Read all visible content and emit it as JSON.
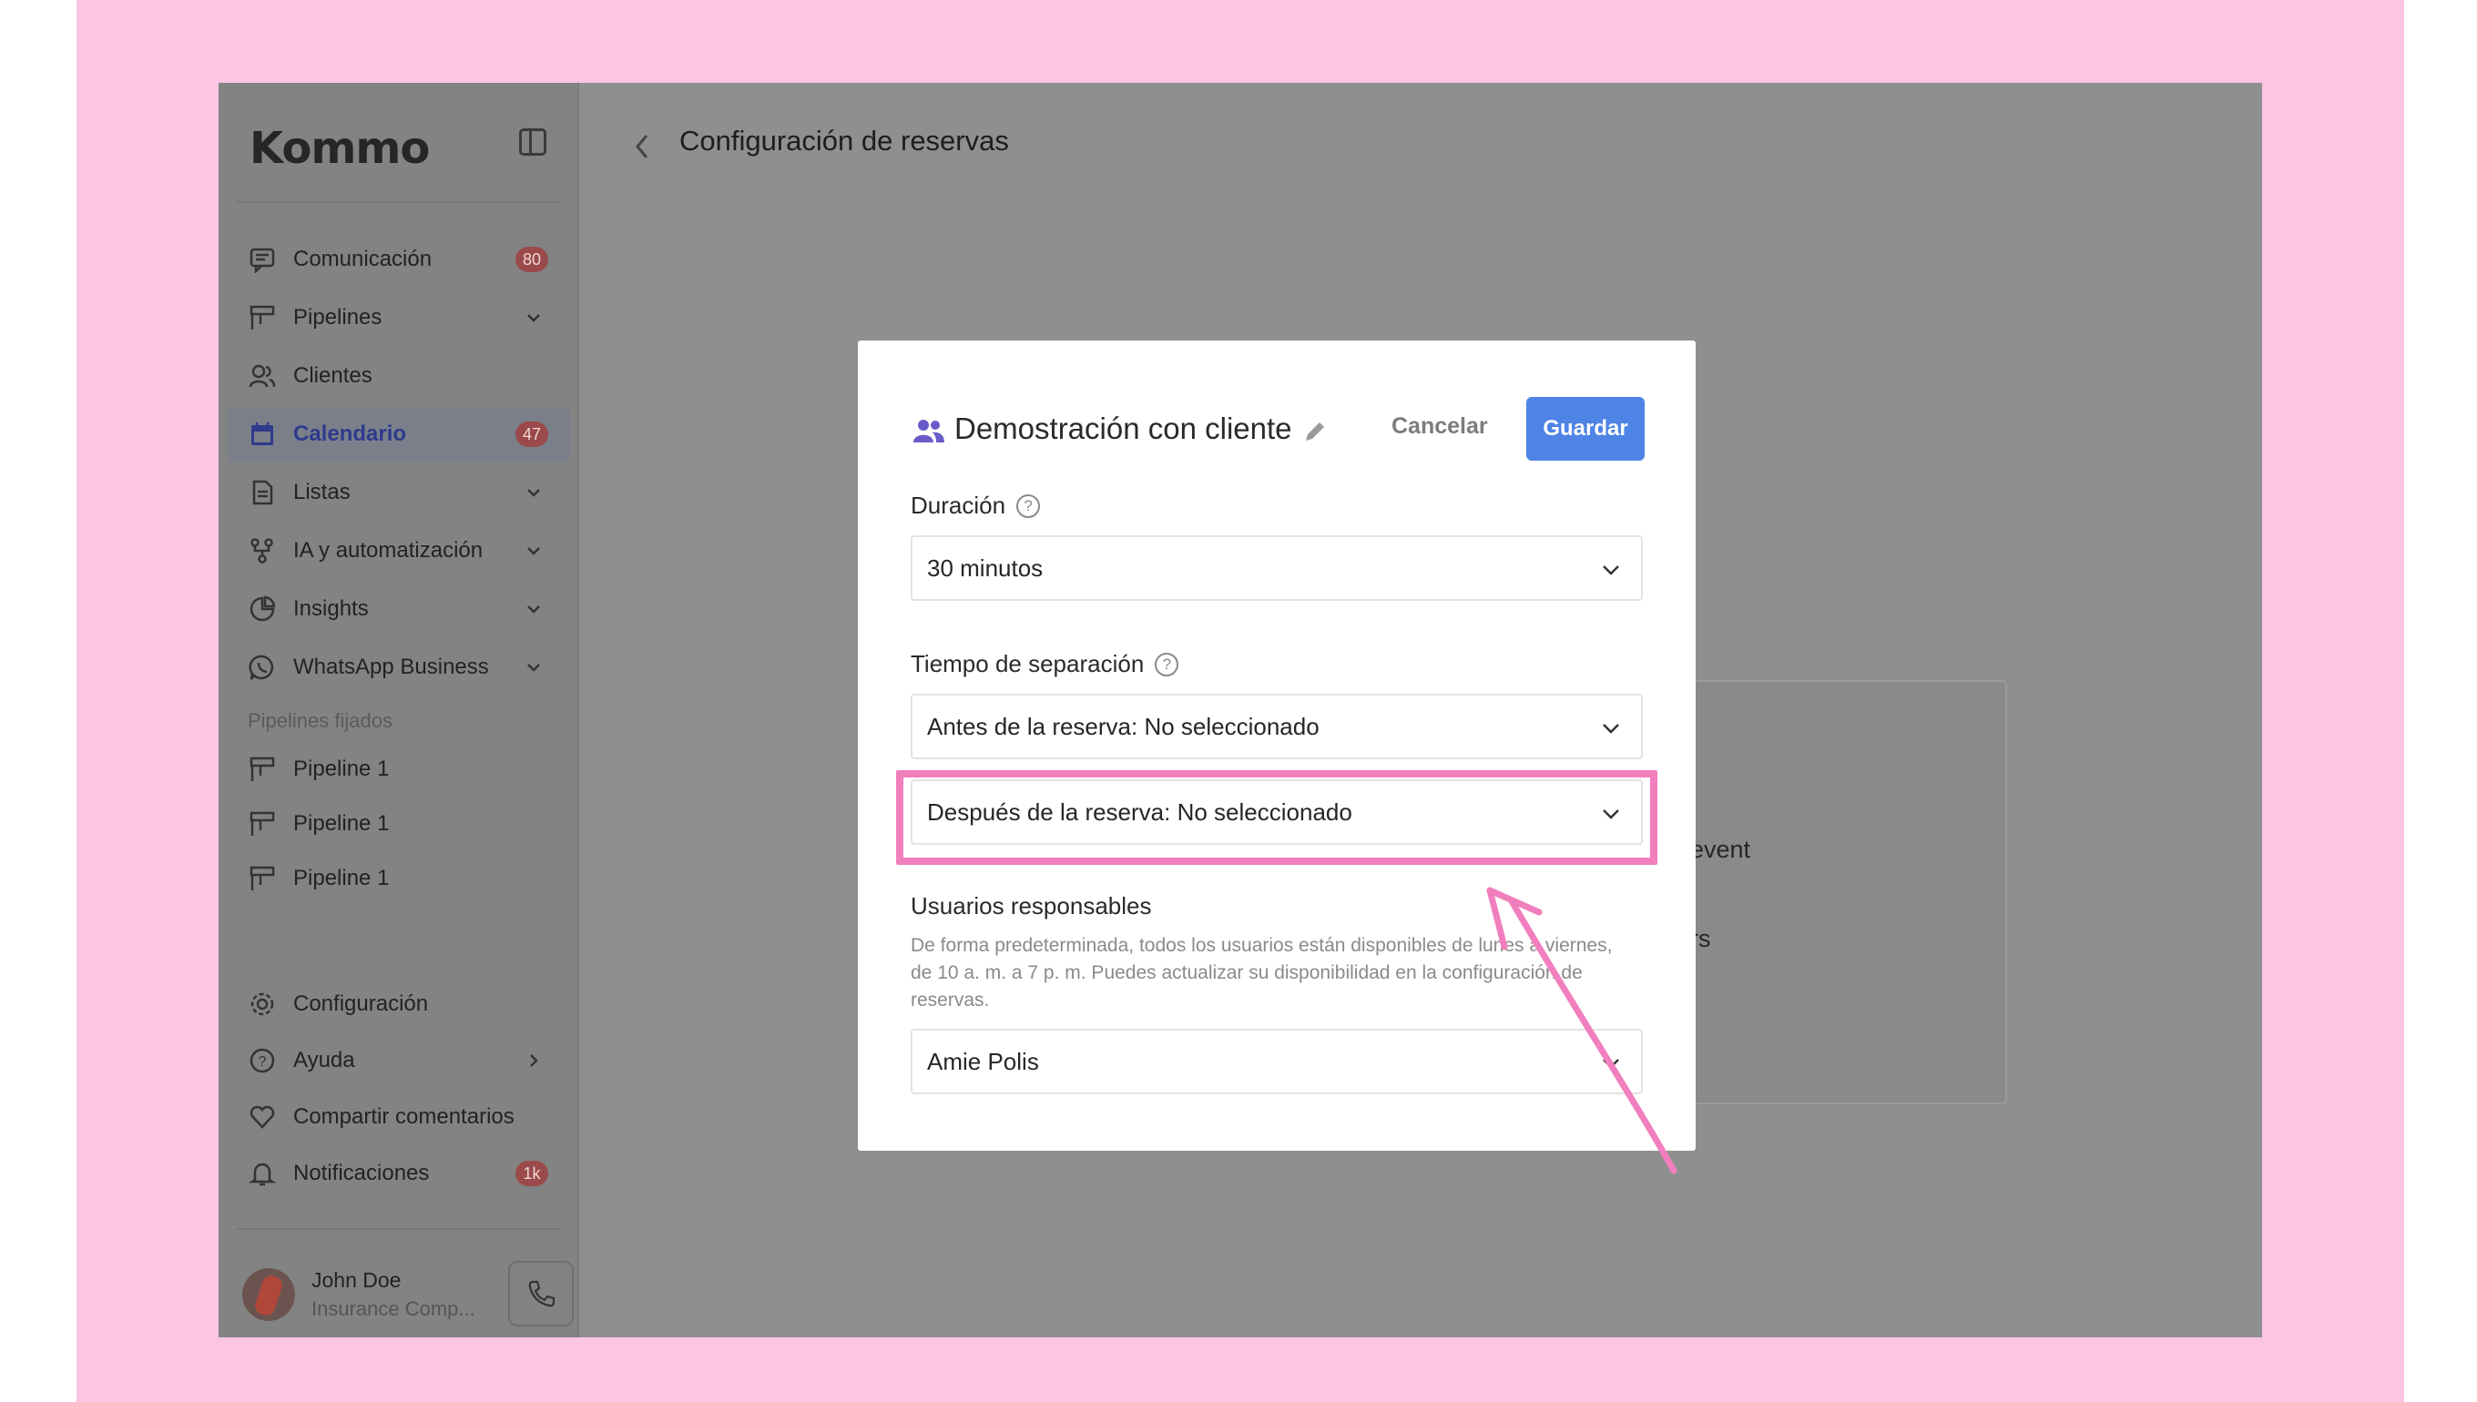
{
  "app": {
    "logo_text": "Kommo",
    "page_title": "Configuración de reservas"
  },
  "sidebar": {
    "items": [
      {
        "label": "Comunicación",
        "badge": "80"
      },
      {
        "label": "Pipelines"
      },
      {
        "label": "Clientes"
      },
      {
        "label": "Calendario",
        "badge": "47",
        "active": true
      },
      {
        "label": "Listas"
      },
      {
        "label": "IA y automatización"
      },
      {
        "label": "Insights"
      },
      {
        "label": "WhatsApp Business"
      }
    ],
    "pinned_section_label": "Pipelines fijados",
    "pinned": [
      {
        "label": "Pipeline 1"
      },
      {
        "label": "Pipeline 1"
      },
      {
        "label": "Pipeline 1"
      }
    ],
    "bottom_items": [
      {
        "label": "Configuración"
      },
      {
        "label": "Ayuda"
      },
      {
        "label": "Compartir comentarios"
      },
      {
        "label": "Notificaciones",
        "badge": "1k"
      }
    ],
    "user": {
      "name": "John Doe",
      "company": "Insurance Comp..."
    }
  },
  "background_card": {
    "text1": "event",
    "text2": "rs"
  },
  "modal": {
    "title": "Demostración con cliente",
    "cancel_label": "Cancelar",
    "save_label": "Guardar",
    "duration": {
      "label": "Duración",
      "value": "30 minutos"
    },
    "buffer": {
      "label": "Tiempo de separación",
      "before_value": "Antes de la reserva: No seleccionado",
      "after_value": "Después de la reserva: No seleccionado"
    },
    "responsible": {
      "label": "Usuarios responsables",
      "helper": "De forma predeterminada, todos los usuarios están disponibles de lunes a viernes, de 10 a. m. a 7 p. m. Puedes actualizar su disponibilidad en la configuración de reservas.",
      "value": "Amie Polis"
    }
  },
  "colors": {
    "accent": "#4e84e6",
    "highlight": "#f27fbd",
    "frame": "#fcc5e3"
  }
}
